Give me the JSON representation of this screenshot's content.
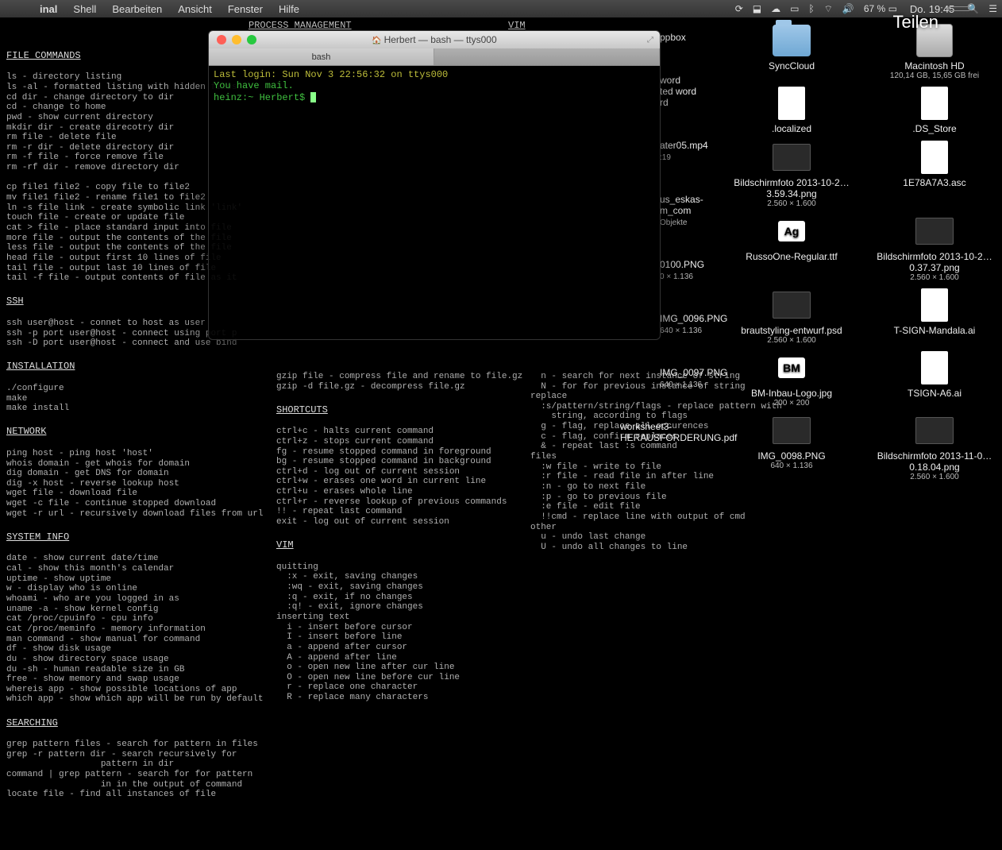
{
  "menubar": {
    "app": "inal",
    "items": [
      "Shell",
      "Bearbeiten",
      "Ansicht",
      "Fenster",
      "Hilfe"
    ],
    "battery": "67 %",
    "clock": "Do. 19:45"
  },
  "overlay": {
    "teilen": "Teilen"
  },
  "terminal": {
    "title": "Herbert — bash — ttys000",
    "tab": "bash",
    "line1": "Last login: Sun Nov  3 22:56:32 on ttys000",
    "line2": "You have mail.",
    "prompt": "heinz:~ Herbert$ "
  },
  "cheat": {
    "file_commands_h": "FILE COMMANDS",
    "file_commands": "ls - directory listing\nls -al - formatted listing with hidden files\ncd dir - change directory to dir\ncd - change to home\npwd - show current directory\nmkdir dir - create direcotry dir\nrm file - delete file\nrm -r dir - delete directory dir\nrm -f file - force remove file\nrm -rf dir - remove directory dir\n\ncp file1 file2 - copy file to file2\nmv file1 file2 - rename file1 to file2\nln -s file link - create symbolic link 'link'\ntouch file - create or update file\ncat > file - place standard input into file\nmore file - output the contents of the file\nless file - output the contents of the file\nhead file - output first 10 lines of file\ntail file - output last 10 lines of file\ntail -f file - output contents of file as it",
    "ssh_h": "SSH",
    "ssh": "ssh user@host - connet to host as user\nssh -p port user@host - connect using port p\nssh -D port user@host - connect and use bind",
    "install_h": "INSTALLATION",
    "install": "./configure\nmake\nmake install",
    "network_h": "NETWORK",
    "network": "ping host - ping host 'host'\nwhois domain - get whois for domain\ndig domain - get DNS for domain\ndig -x host - reverse lookup host\nwget file - download file\nwget -c file - continue stopped download\nwget -r url - recursively download files from url",
    "sysinfo_h": "SYSTEM INFO",
    "sysinfo": "date - show current date/time\ncal - show this month's calendar\nuptime - show uptime\nw - display who is online\nwhoami - who are you logged in as\nuname -a - show kernel config\ncat /proc/cpuinfo - cpu info\ncat /proc/meminfo - memory information\nman command - show manual for command\ndf - show disk usage\ndu - show directory space usage\ndu -sh - human readable size in GB\nfree - show memory and swap usage\nwhereis app - show possible locations of app\nwhich app - show which app will be run by default",
    "search_h": "SEARCHING",
    "search": "grep pattern files - search for pattern in files\ngrep -r pattern dir - search recursively for\n                  pattern in dir\ncommand | grep pattern - search for for pattern\n                  in in the output of command\nlocate file - find all instances of file",
    "process_h": "PROCESS MANAGEMENT",
    "gzip": "gzip file - compress file and rename to file.gz\ngzip -d file.gz - decompress file.gz",
    "shortcuts_h": "SHORTCUTS",
    "shortcuts": "ctrl+c - halts current command\nctrl+z - stops current command\nfg - resume stopped command in foreground\nbg - resume stopped command in background\nctrl+d - log out of current session\nctrl+w - erases one word in current line\nctrl+u - erases whole line\nctrl+r - reverse lookup of previous commands\n!! - repeat last command\nexit - log out of current session",
    "vim_h": "VIM",
    "vim_quit": "quitting\n  :x - exit, saving changes\n  :wq - exit, saving changes\n  :q - exit, if no changes\n  :q! - exit, ignore changes\ninserting text\n  i - insert before cursor\n  I - insert before line\n  a - append after cursor\n  A - append after line\n  o - open new line after cur line\n  O - open new line before cur line\n  r - replace one character\n  R - replace many characters",
    "vim_h2": "VIM",
    "vim_search": "  n - search for next instance of string\n  N - for for previous instance of string\nreplace\n  :s/pattern/string/flags - replace pattern with\n    string, according to flags\n  g - flag, replace all occurences\n  c - flag, confirm replaces\n  & - repeat last :s command\nfiles\n  :w file - write to file\n  :r file - read file in after line\n  :n - go to next file\n  :p - go to previous file\n  :e file - edit file\n  !!cmd - replace line with output of cmd\nother\n  u - undo last change\n  U - undo all changes to line"
  },
  "partial": {
    "i1": "ppbox",
    "i2a": "word",
    "i2b": "ted word",
    "i2c": "rd",
    "i3": "ater05.mp4",
    "i3s": ":19",
    "i4a": "us_eskas-",
    "i4b": "m_com",
    "i4c": "Objekte",
    "i5": "0100.PNG",
    "i5s": "0 × 1.136",
    "i6": "IMG_0096.PNG",
    "i6s": "640 × 1.136",
    "i7": "IMG_0097.PNG",
    "i7s": "640 × 1.136",
    "i8a": "worksheet3-",
    "i8b": "HERAUSFORDERUNG.pdf"
  },
  "desktop": {
    "r1": [
      {
        "name": "SyncCloud",
        "type": "folder"
      },
      {
        "name": "Macintosh HD",
        "sub": "120,14 GB, 15,65 GB frei",
        "type": "hd"
      }
    ],
    "r2": [
      {
        "name": ".localized",
        "type": "file"
      },
      {
        "name": ".DS_Store",
        "type": "file"
      }
    ],
    "r3": [
      {
        "name": "Bildschirmfoto 2013-10-2…3.59.34.png",
        "sub": "2.560 × 1.600",
        "type": "thumb"
      },
      {
        "name": "1E78A7A3.asc",
        "type": "file"
      }
    ],
    "r4": [
      {
        "name": "RussoOne-Regular.ttf",
        "type": "badge",
        "badge": "Ag"
      },
      {
        "name": "Bildschirmfoto 2013-10-2…0.37.37.png",
        "sub": "2.560 × 1.600",
        "type": "thumb"
      }
    ],
    "r5": [
      {
        "name": "brautstyling-entwurf.psd",
        "sub": "2.560 × 1.600",
        "type": "thumb"
      },
      {
        "name": "T-SIGN-Mandala.ai",
        "type": "file"
      }
    ],
    "r6": [
      {
        "name": "BM-Inbau-Logo.jpg",
        "sub": "200 × 200",
        "type": "badge",
        "badge": "BM"
      },
      {
        "name": "TSIGN-A6.ai",
        "type": "file"
      }
    ],
    "r7": [
      {
        "name": "IMG_0098.PNG",
        "sub": "640 × 1.136",
        "type": "thumb"
      },
      {
        "name": "Bildschirmfoto 2013-11-0…0.18.04.png",
        "sub": "2.560 × 1.600",
        "type": "thumb"
      }
    ]
  }
}
